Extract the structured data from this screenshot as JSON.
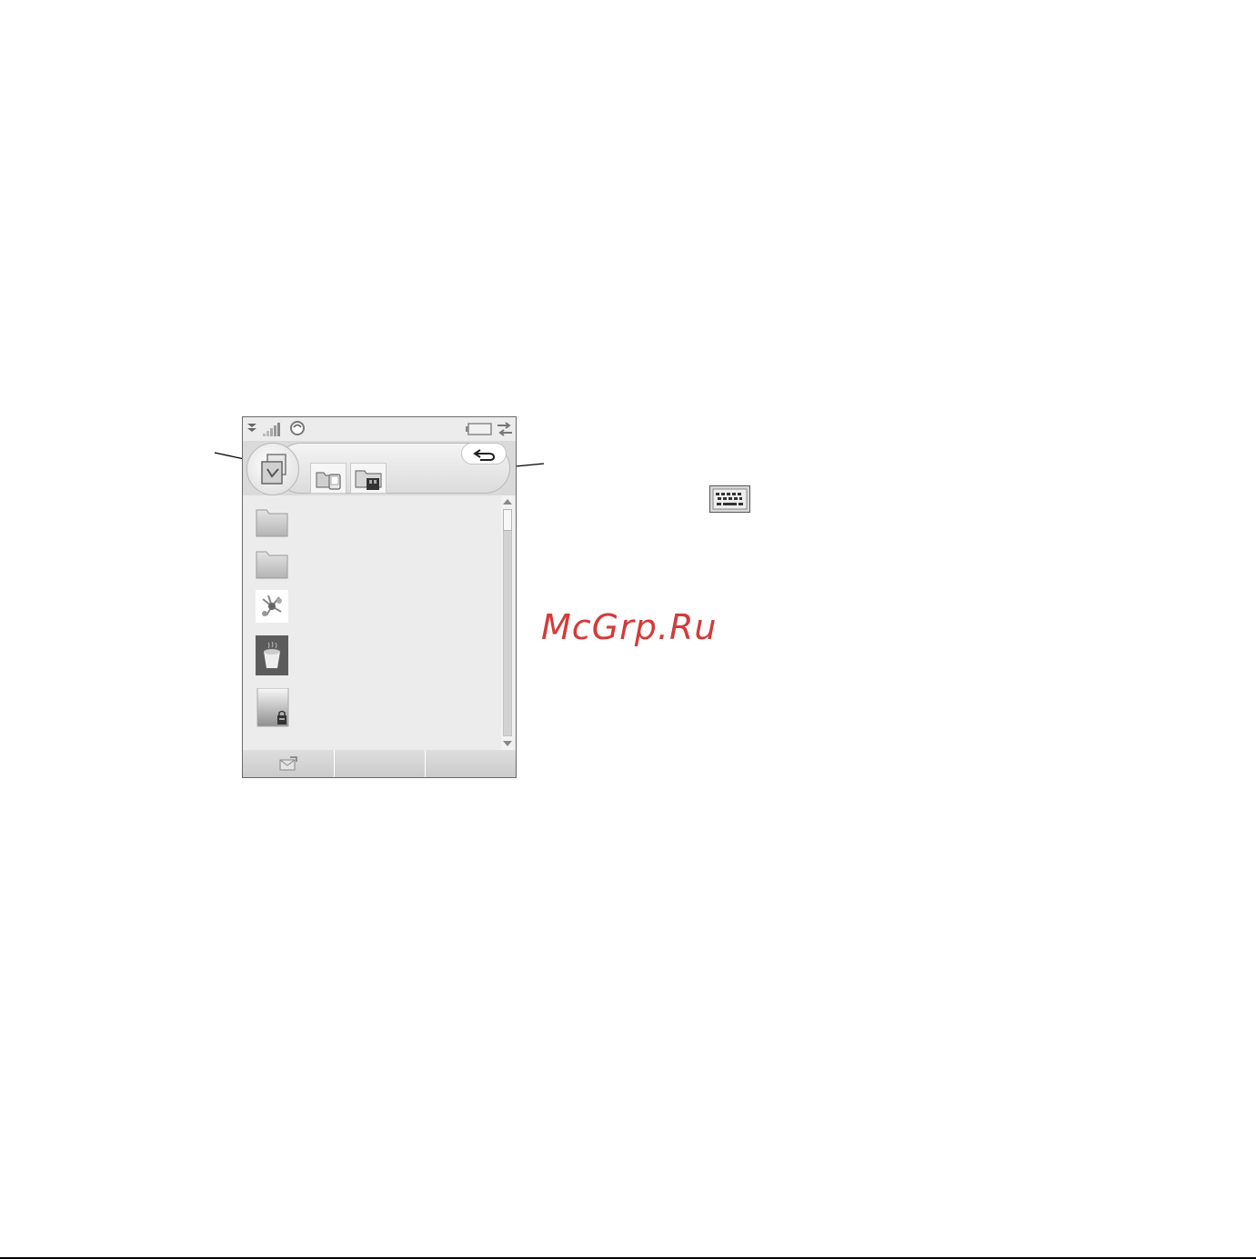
{
  "watermark": {
    "text": "McGrp.Ru",
    "color": "#d33b3b"
  },
  "phone": {
    "status_bar": {
      "icons": [
        "menu-arrow-icon",
        "signal-strength-icon",
        "status-indicator-icon",
        "battery-icon",
        "connectivity-icon"
      ]
    },
    "header": {
      "app_icon": "file-manager-icon",
      "tabs": [
        {
          "icon": "phone-memory-folder-icon"
        },
        {
          "icon": "memory-stick-folder-icon"
        }
      ],
      "back_icon": "back-arrow-icon"
    },
    "list": {
      "items": [
        {
          "icon": "folder-icon"
        },
        {
          "icon": "folder-icon"
        },
        {
          "icon": "image-thumbnail-icon"
        },
        {
          "icon": "cup-thumbnail-icon"
        },
        {
          "icon": "locked-file-icon"
        }
      ]
    },
    "scrollbar": {
      "position": 0
    },
    "softkeys": [
      {
        "icon": "send-icon"
      },
      {
        "icon": ""
      },
      {
        "icon": ""
      }
    ]
  },
  "side_icon": "keyboard-icon",
  "colors": {
    "screen_bg": "#e9e9e9",
    "accent": "#d33b3b"
  }
}
